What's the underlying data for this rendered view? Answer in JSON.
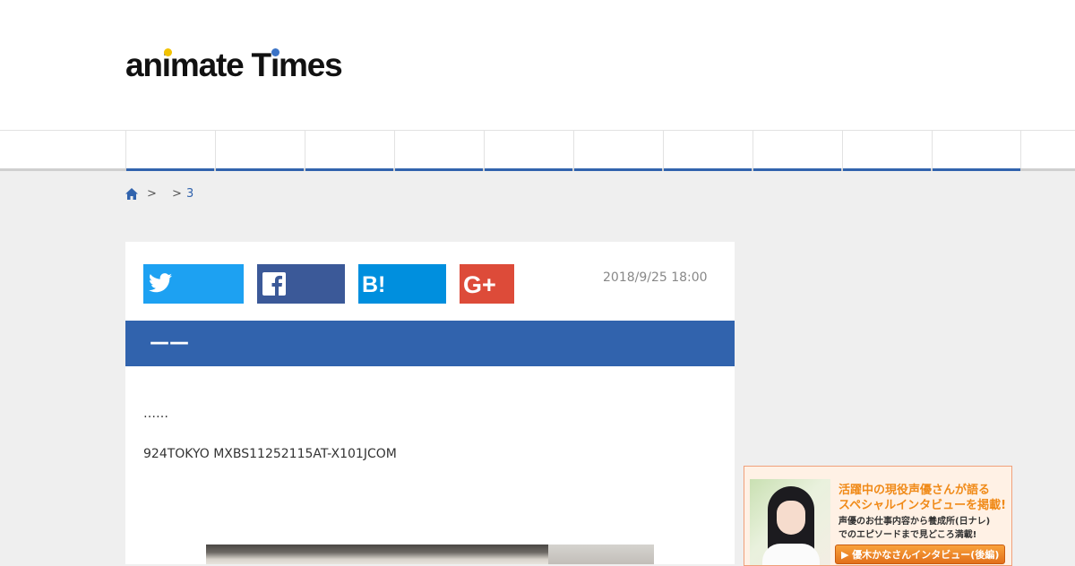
{
  "header": {
    "logo_part1": "an",
    "logo_i": "i",
    "logo_part2": "mate ",
    "logo_t": "T",
    "logo_part3": "imes",
    "logo_i_dot_color": "#f2c200",
    "logo_t_dot_color": "#3b73c6"
  },
  "nav": {
    "item_count": 10,
    "accent_color": "#3163ad"
  },
  "breadcrumb": {
    "home_icon": "home-icon",
    "sep1": ">",
    "sep2": ">",
    "current": "3"
  },
  "article": {
    "share": {
      "twitter_icon": "twitter-icon",
      "facebook_icon": "facebook-icon",
      "hatena_icon": "hatena-bookmark-icon",
      "googleplus_icon": "google-plus-icon"
    },
    "date": "2018/9/25 18:00",
    "title": "——",
    "paragraphs": [
      "……",
      "924TOKYO MXBS11252115AT-X101JCOM"
    ]
  },
  "sidebar_banner": {
    "line1": "活躍中の現役声優さんが語る",
    "line2": "スペシャルインタビューを掲載!",
    "line3": "声優のお仕事内容から養成所(日ナレ)",
    "line4": "でのエピソードまで見どころ満載!",
    "button_label": "▶ 優木かなさんインタビュー(後編)"
  },
  "colors": {
    "brand_blue": "#3163ad",
    "twitter": "#1da1f2",
    "facebook": "#3b5998",
    "hatena": "#008fde",
    "googleplus": "#dd4b39"
  }
}
